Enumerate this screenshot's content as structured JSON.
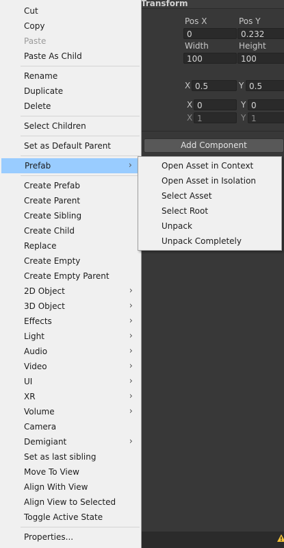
{
  "inspector": {
    "title": "Transform",
    "pos_x_label": "Pos X",
    "pos_y_label": "Pos Y",
    "pos_x": "0",
    "pos_y": "0.232",
    "width_label": "Width",
    "height_label": "Height",
    "width": "100",
    "height": "100",
    "pivot_x_label": "X",
    "pivot_x": "0.5",
    "pivot_y_label": "Y",
    "pivot_y": "0.5",
    "rot_x_label": "X",
    "rot_x": "0",
    "rot_y_label": "Y",
    "rot_y": "0",
    "scale_x_label": "X",
    "scale_x": "1",
    "scale_y_label": "Y",
    "scale_y": "1",
    "add_component": "Add Component"
  },
  "menu": {
    "cut": "Cut",
    "copy": "Copy",
    "paste": "Paste",
    "paste_as_child": "Paste As Child",
    "rename": "Rename",
    "duplicate": "Duplicate",
    "delete": "Delete",
    "select_children": "Select Children",
    "set_default_parent": "Set as Default Parent",
    "prefab": "Prefab",
    "create_prefab": "Create Prefab",
    "create_parent": "Create Parent",
    "create_sibling": "Create Sibling",
    "create_child": "Create Child",
    "replace": "Replace",
    "create_empty": "Create Empty",
    "create_empty_parent": "Create Empty Parent",
    "obj_2d": "2D Object",
    "obj_3d": "3D Object",
    "effects": "Effects",
    "light": "Light",
    "audio": "Audio",
    "video": "Video",
    "ui": "UI",
    "xr": "XR",
    "volume": "Volume",
    "camera": "Camera",
    "demigiant": "Demigiant",
    "set_last_sibling": "Set as last sibling",
    "move_to_view": "Move To View",
    "align_with_view": "Align With View",
    "align_view_selected": "Align View to Selected",
    "toggle_active": "Toggle Active State",
    "properties": "Properties..."
  },
  "submenu": {
    "open_context": "Open Asset in Context",
    "open_isolation": "Open Asset in Isolation",
    "select_asset": "Select Asset",
    "select_root": "Select Root",
    "unpack": "Unpack",
    "unpack_completely": "Unpack Completely"
  },
  "icons": {
    "submenu_arrow": "chevron-right-icon",
    "warning": "warning-icon"
  },
  "colors": {
    "menu_bg": "#f0f0f0",
    "highlight": "#99ccff",
    "inspector_bg": "#383838"
  }
}
